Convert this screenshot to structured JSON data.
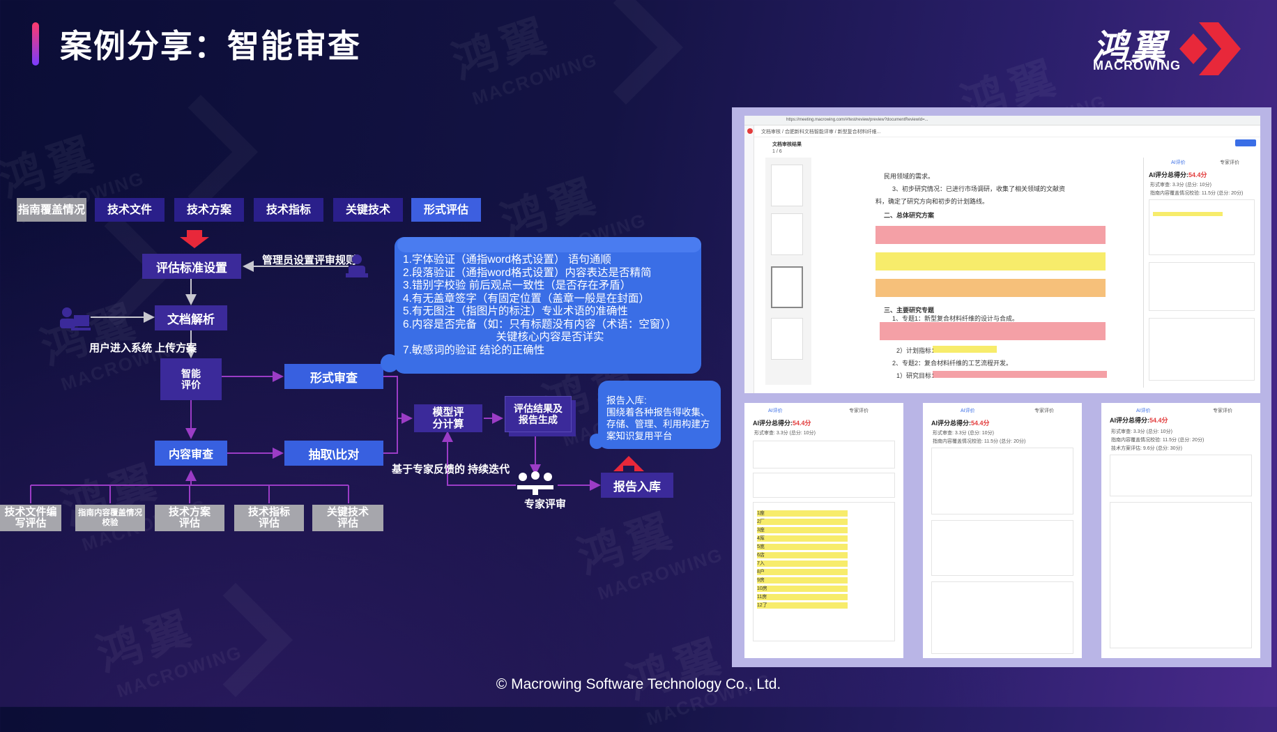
{
  "title": "案例分享：智能审查",
  "logo": {
    "cn": "鸿翼",
    "en": "MACROWING"
  },
  "watermark": {
    "cn": "鸿翼",
    "en": "MACROWING"
  },
  "top_tabs": [
    "指南覆盖情况",
    "技术文件",
    "技术方案",
    "技术指标",
    "关键技术",
    "形式评估"
  ],
  "flow": {
    "criteria": "评估标准设置",
    "admin_label": "管理员设置评审规则",
    "doc_parse": "文档解析",
    "user_label": "用户进入系统 上传方案",
    "smart_eval": "智能评价",
    "form_review": "形式审查",
    "content_review": "内容审查",
    "extract_compare": "抽取\\比对",
    "model_score": "模型评分计算",
    "result_report": "评估结果及报告生成",
    "feedback_label": "基于专家反馈的 持续迭代",
    "expert_review": "专家评审",
    "report_store": "报告入库",
    "bottom_items": [
      "技术文件编写评估",
      "指南内容覆盖情况校验",
      "技术方案评估",
      "技术指标评估",
      "关键技术评估"
    ]
  },
  "rules": [
    "1.字体验证（通指word格式设置）          语句通顺",
    "2.段落验证（通指word格式设置）内容表达是否精简",
    "3.错别字校验          前后观点一致性（是否存在矛盾）",
    "4.有无盖章签字（有固定位置（盖章一般是在封面）",
    "5.有无图注（指图片的标注）专业术语的准确性",
    "6.内容是否完备（如：只有标题没有内容（术语：空窗））",
    "                               关键核心内容是否详实",
    "7.敏感词的验证       结论的正确性"
  ],
  "report_box": [
    "报告入库:",
    "围绕着各种报告得收集、",
    "存储、管理、利用构建方",
    "案知识复用平台"
  ],
  "screenshot": {
    "url": "https://meeting.macrowing.com/#/test/review/preview?documentReviewId=...",
    "breadcrumb": "文档审核 / 合肥新科文档智能评审 / 新型复合材料纤维...",
    "doc_title": "文档审核结果",
    "page_indicator": "1 / 6",
    "tab_ai": "AI评价",
    "tab_expert": "专家评价",
    "score_label": "AI评分总得分:",
    "score_value": "54.4分",
    "doc_lines": [
      "民用领域的需求。",
      "3、初步研究情况：已进行市场调研，收集了相关领域的文献资",
      "料，确定了研究方向和初步的计划路线。",
      "二、总体研究方案",
      "三、主要研究专题",
      "1、专题1：新型复合材料纤维的设计与合成。",
      "2）计划指标：",
      "2、专题2：复合材料纤维的工艺流程开发。",
      "1）研究目标："
    ],
    "score_items": {
      "form": "形式审查: 3.3分 (总分: 10分)",
      "guide": "指南内容覆盖情况校验: 11.5分 (总分: 20分)",
      "tech": "技术方案评估: 9.6分 (总分: 30分)"
    },
    "typo_list": [
      "1座",
      "2厂",
      "3座",
      "4厍",
      "5底",
      "6店",
      "7入",
      "8户",
      "9房",
      "10房",
      "11房",
      "12了"
    ]
  }
}
